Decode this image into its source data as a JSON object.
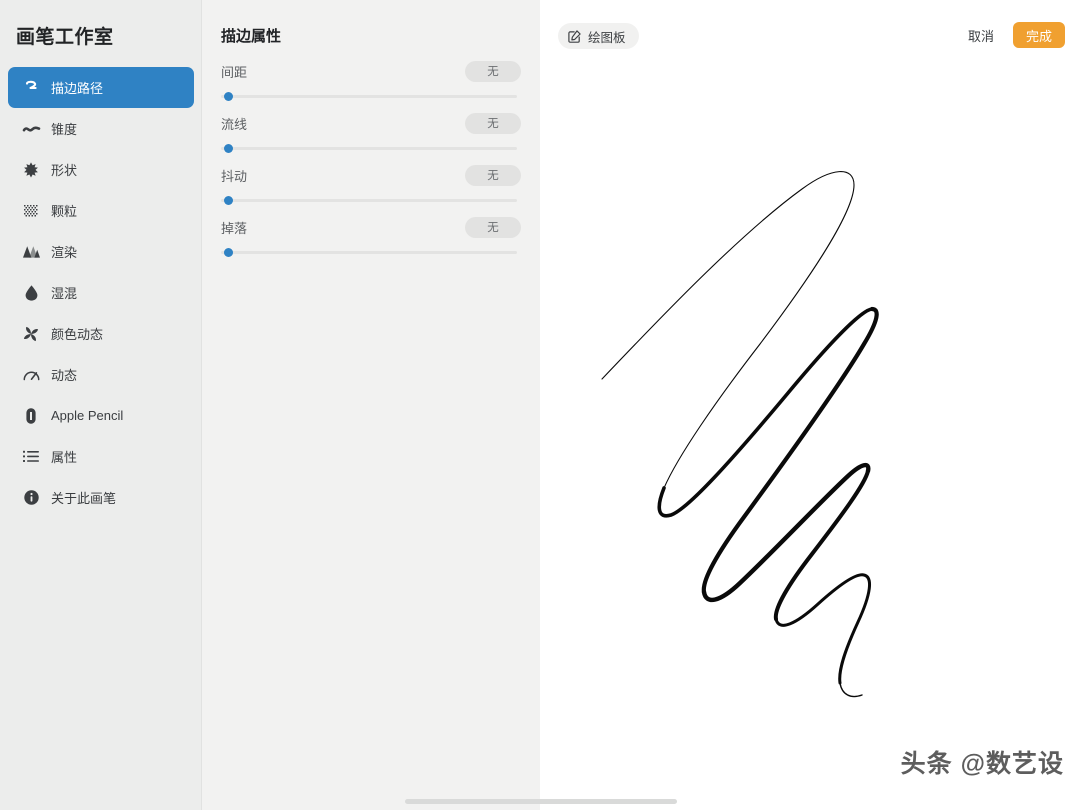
{
  "sidebar": {
    "title": "画笔工作室",
    "items": [
      {
        "label": "描边路径",
        "icon": "stroke-path-icon",
        "active": true
      },
      {
        "label": "锥度",
        "icon": "taper-wave-icon",
        "active": false
      },
      {
        "label": "形状",
        "icon": "shape-star-icon",
        "active": false
      },
      {
        "label": "颗粒",
        "icon": "grain-icon",
        "active": false
      },
      {
        "label": "渲染",
        "icon": "render-peaks-icon",
        "active": false
      },
      {
        "label": "湿混",
        "icon": "wet-mix-drop-icon",
        "active": false
      },
      {
        "label": "颜色动态",
        "icon": "color-dynamics-pinwheel-icon",
        "active": false
      },
      {
        "label": "动态",
        "icon": "dynamics-gauge-icon",
        "active": false
      },
      {
        "label": "Apple Pencil",
        "icon": "apple-pencil-icon",
        "active": false
      },
      {
        "label": "属性",
        "icon": "attributes-list-icon",
        "active": false
      },
      {
        "label": "关于此画笔",
        "icon": "info-icon",
        "active": false
      }
    ]
  },
  "properties": {
    "title": "描边属性",
    "sliders": [
      {
        "label": "间距",
        "value_label": "无",
        "value_pct": 0
      },
      {
        "label": "流线",
        "value_label": "无",
        "value_pct": 0
      },
      {
        "label": "抖动",
        "value_label": "无",
        "value_pct": 0
      },
      {
        "label": "掉落",
        "value_label": "无",
        "value_pct": 0
      }
    ]
  },
  "toolbar": {
    "drawpad_label": "绘图板",
    "drawpad_icon": "edit-square-icon",
    "cancel_label": "取消",
    "done_label": "完成"
  },
  "watermark": {
    "text": "头条 @数艺设"
  },
  "colors": {
    "accent_blue": "#2F82C4",
    "accent_orange": "#F0A030",
    "sidebar_bg": "#ECEDEC",
    "panel_bg": "#F2F2F1",
    "canvas_bg": "#FFFFFF",
    "stroke_black": "#0A0A0A"
  }
}
